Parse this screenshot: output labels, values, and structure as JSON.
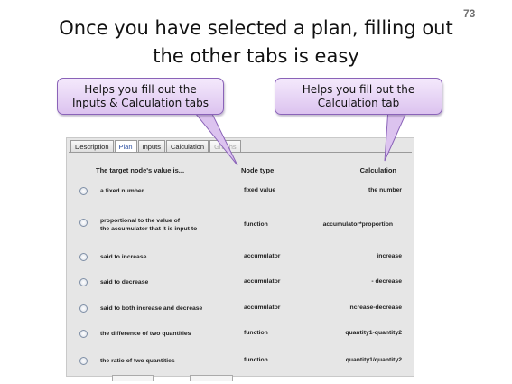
{
  "slide_number": "73",
  "title": {
    "line1": "Once you have selected a plan,  filling out",
    "line2": "the other tabs is easy"
  },
  "callouts": [
    {
      "line1": "Helps you fill out the",
      "line2": "Inputs & Calculation tabs"
    },
    {
      "line1": "Helps you fill out the",
      "line2": "Calculation tab"
    }
  ],
  "colors": {
    "callout_fill": "#e6d3f5",
    "callout_border": "#8a63b8",
    "active_tab_text": "#2b4fa0"
  },
  "tabs": [
    {
      "label": "Description",
      "state": "normal"
    },
    {
      "label": "Plan",
      "state": "active"
    },
    {
      "label": "Inputs",
      "state": "normal"
    },
    {
      "label": "Calculation",
      "state": "normal"
    },
    {
      "label": "Graphs",
      "state": "disabled"
    }
  ],
  "table": {
    "headers": {
      "description": "The target node's value is...",
      "node_type": "Node type",
      "calculation": "Calculation"
    },
    "rows": [
      {
        "desc1": "a fixed number",
        "desc2": "",
        "type": "fixed value",
        "calc": "the number"
      },
      {
        "desc1": "proportional to the value of",
        "desc2": "the accumulator that it is input to",
        "type": "function",
        "calc": "accumulator*proportion"
      },
      {
        "desc1": "said to increase",
        "desc2": "",
        "type": "accumulator",
        "calc": "increase"
      },
      {
        "desc1": "said to decrease",
        "desc2": "",
        "type": "accumulator",
        "calc": "- decrease"
      },
      {
        "desc1": "said to both increase and decrease",
        "desc2": "",
        "type": "accumulator",
        "calc": "increase-decrease"
      },
      {
        "desc1": "the difference of two quantities",
        "desc2": "",
        "type": "function",
        "calc": "quantity1-quantity2"
      },
      {
        "desc1": "the ratio of two quantities",
        "desc2": "",
        "type": "function",
        "calc": "quantity1/quantity2"
      }
    ]
  }
}
